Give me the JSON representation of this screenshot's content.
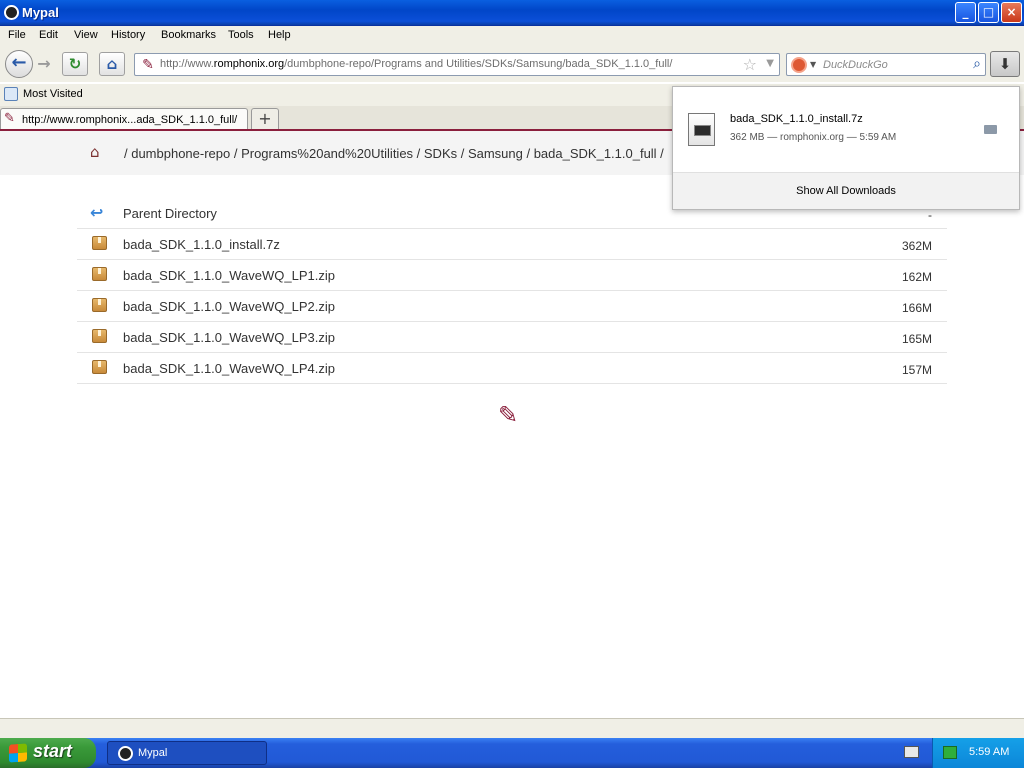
{
  "window": {
    "title": "Mypal",
    "minimize": "_",
    "maximize": "□",
    "close": "×"
  },
  "menu": [
    "File",
    "Edit",
    "View",
    "History",
    "Bookmarks",
    "Tools",
    "Help"
  ],
  "nav": {
    "back_icon": "←",
    "forward_icon": "→",
    "reload_icon": "↻",
    "home_icon": "⌂",
    "url_prefix": "http://www.",
    "url_domain": "romphonix.org",
    "url_path": "/dumbphone-repo/Programs and Utilities/SDKs/Samsung/bada_SDK_1.1.0_full/",
    "search_placeholder": "DuckDuckGo",
    "download_icon": "⬇"
  },
  "bookmarks": {
    "label": "Most Visited"
  },
  "tab": {
    "title": "http://www.romphonix...ada_SDK_1.1.0_full/",
    "new_tab": "+"
  },
  "breadcrumb": "/ dumbphone-repo / Programs%20and%20Utilities / SDKs / Samsung / bada_SDK_1.1.0_full /",
  "files": [
    {
      "name": "Parent Directory",
      "size": "-",
      "kind": "parent"
    },
    {
      "name": "bada_SDK_1.1.0_install.7z",
      "size": "362M",
      "kind": "file"
    },
    {
      "name": "bada_SDK_1.1.0_WaveWQ_LP1.zip",
      "size": "162M",
      "kind": "file"
    },
    {
      "name": "bada_SDK_1.1.0_WaveWQ_LP2.zip",
      "size": "166M",
      "kind": "file"
    },
    {
      "name": "bada_SDK_1.1.0_WaveWQ_LP3.zip",
      "size": "165M",
      "kind": "file"
    },
    {
      "name": "bada_SDK_1.1.0_WaveWQ_LP4.zip",
      "size": "157M",
      "kind": "file"
    }
  ],
  "downloads": {
    "item_name": "bada_SDK_1.1.0_install.7z",
    "item_meta": "362 MB — romphonix.org — 5:59 AM",
    "footer": "Show All Downloads"
  },
  "taskbar": {
    "start": "start",
    "task": "Mypal",
    "clock": "5:59 AM"
  },
  "colors": {
    "accent": "#8a1f3c",
    "titlebar": "#0146c8",
    "start": "#3a9a3a"
  }
}
